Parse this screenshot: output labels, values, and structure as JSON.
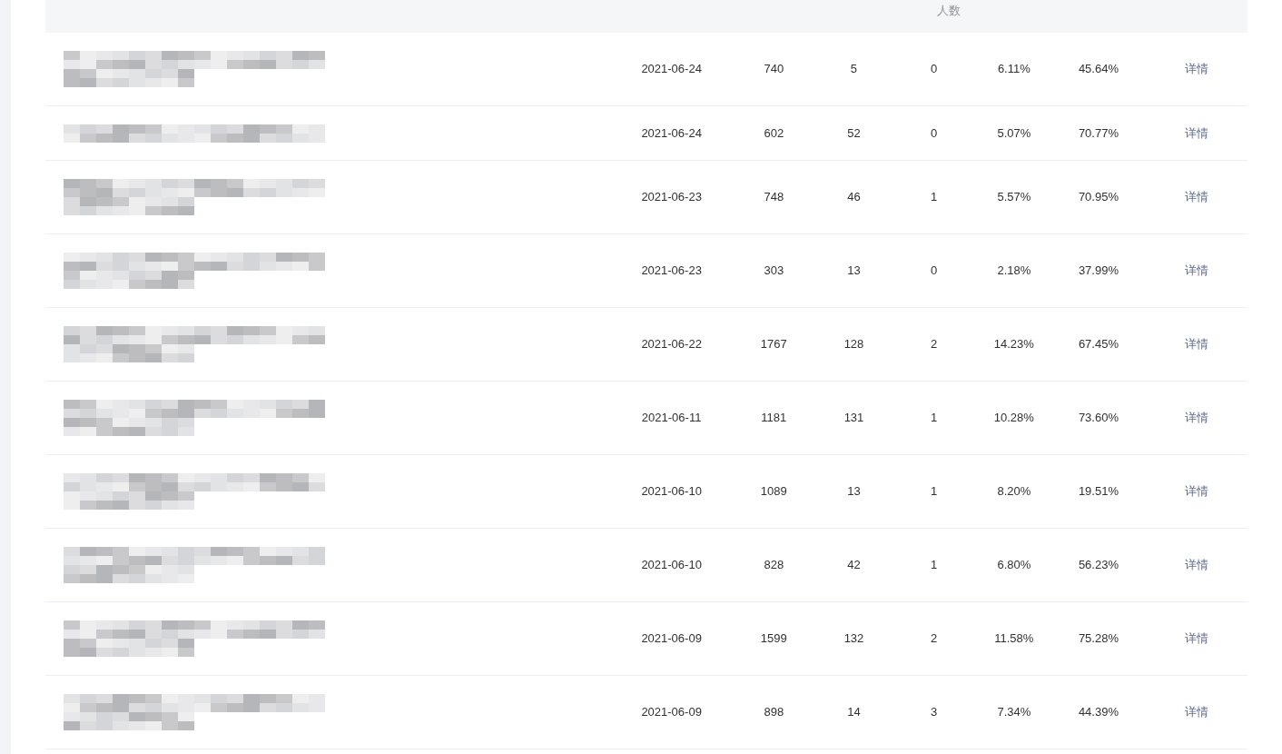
{
  "table": {
    "header_fragment": "人数",
    "rows": [
      {
        "date": "2021-06-24",
        "column_3": "740",
        "column_4": "5",
        "column_5": "0",
        "column_6": "6.11%",
        "column_7": "45.64%",
        "action": "详情"
      },
      {
        "date": "2021-06-24",
        "column_3": "602",
        "column_4": "52",
        "column_5": "0",
        "column_6": "5.07%",
        "column_7": "70.77%",
        "action": "详情"
      },
      {
        "date": "2021-06-23",
        "column_3": "748",
        "column_4": "46",
        "column_5": "1",
        "column_6": "5.57%",
        "column_7": "70.95%",
        "action": "详情"
      },
      {
        "date": "2021-06-23",
        "column_3": "303",
        "column_4": "13",
        "column_5": "0",
        "column_6": "2.18%",
        "column_7": "37.99%",
        "action": "详情"
      },
      {
        "date": "2021-06-22",
        "column_3": "1767",
        "column_4": "128",
        "column_5": "2",
        "column_6": "14.23%",
        "column_7": "67.45%",
        "action": "详情"
      },
      {
        "date": "2021-06-11",
        "column_3": "1181",
        "column_4": "131",
        "column_5": "1",
        "column_6": "10.28%",
        "column_7": "73.60%",
        "action": "详情"
      },
      {
        "date": "2021-06-10",
        "column_3": "1089",
        "column_4": "13",
        "column_5": "1",
        "column_6": "8.20%",
        "column_7": "19.51%",
        "action": "详情"
      },
      {
        "date": "2021-06-10",
        "column_3": "828",
        "column_4": "42",
        "column_5": "1",
        "column_6": "6.80%",
        "column_7": "56.23%",
        "action": "详情"
      },
      {
        "date": "2021-06-09",
        "column_3": "1599",
        "column_4": "132",
        "column_5": "2",
        "column_6": "11.58%",
        "column_7": "75.28%",
        "action": "详情"
      },
      {
        "date": "2021-06-09",
        "column_3": "898",
        "column_4": "14",
        "column_5": "3",
        "column_6": "7.34%",
        "column_7": "44.39%",
        "action": "详情"
      }
    ]
  }
}
